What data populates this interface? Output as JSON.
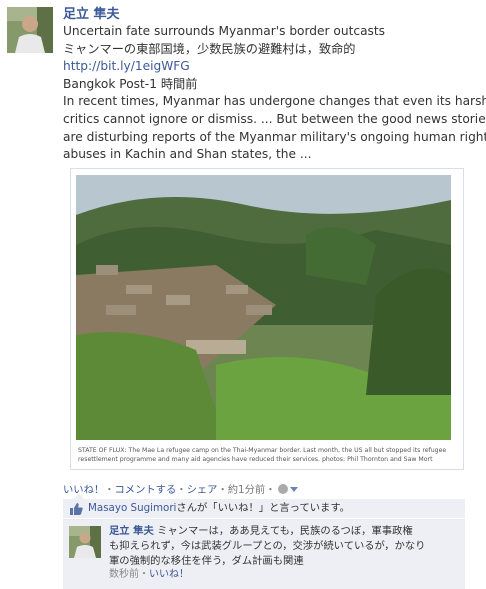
{
  "post": {
    "author": "足立 隼夫",
    "lines": [
      "Uncertain fate surrounds Myanmar's border outcasts",
      "ミャンマーの東部国境，少数民族の避難村は，致命的"
    ],
    "link": "http://bit.ly/1eigWFG",
    "source_time": "Bangkok Post-1 時間前",
    "excerpt_lines": [
      "In recent times, Myanmar has undergone changes that even its harshest",
      "critics cannot ignore or dismiss. ... But between the good news stories",
      "are disturbing reports of the Myanmar military's ongoing human rights",
      "abuses in Kachin and Shan states, the ..."
    ]
  },
  "photo": {
    "caption_lines": [
      "STATE OF FLUX: The Mae La refugee camp on the Thai-Myanmar border. Last month, the US all but stopped its refugee",
      "resettlement programme and many aid agencies have reduced their services. photos: Phil Thornton and Saw Mort"
    ]
  },
  "actions": {
    "like": "いいね！",
    "comment": "コメントする",
    "share": "シェア",
    "time": "約1分前",
    "separator": "・"
  },
  "likes": {
    "name": "Masayo Sugimori",
    "suffix": "さんが「いいね！」と言っています。"
  },
  "comment": {
    "author": "足立 隼夫",
    "first_line": "ミャンマーは，ああ見えても，民族のるつぼ，軍事政権",
    "lines": [
      "も抑えられず，今は武装グループとの，交渉が続いているが，かなり",
      "軍の強制的な移住を伴う，ダム計画も関連"
    ],
    "time": "数秒前",
    "separator": "・",
    "like": "いいね！"
  },
  "colors": {
    "link": "#3b5998",
    "box_bg": "#edeff4",
    "text": "#333333",
    "meta": "#777777"
  },
  "icons": [
    "globe-icon",
    "chevron-down-icon",
    "thumbs-up-icon"
  ]
}
